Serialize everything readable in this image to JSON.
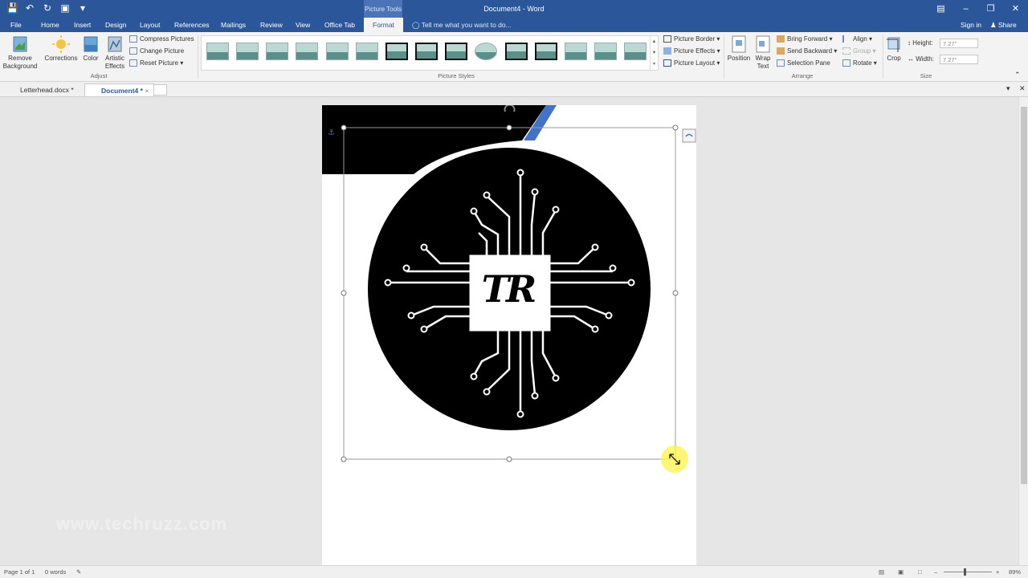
{
  "titlebar": {
    "doc_title": "Document4 - Word",
    "context_label": "Picture Tools"
  },
  "tabs": {
    "file": "File",
    "home": "Home",
    "insert": "Insert",
    "design": "Design",
    "layout": "Layout",
    "references": "References",
    "mailings": "Mailings",
    "review": "Review",
    "view": "View",
    "office_tab": "Office Tab",
    "format": "Format",
    "tell_me": "Tell me what you want to do...",
    "sign_in": "Sign in",
    "share": "Share"
  },
  "ribbon": {
    "remove_background": "Remove Background",
    "corrections": "Corrections",
    "color": "Color",
    "artistic_effects": "Artistic Effects",
    "compress_pictures": "Compress Pictures",
    "change_picture": "Change Picture",
    "reset_picture": "Reset Picture",
    "group_adjust": "Adjust",
    "group_picture_styles": "Picture Styles",
    "picture_border": "Picture Border",
    "picture_effects": "Picture Effects",
    "picture_layout": "Picture Layout",
    "position": "Position",
    "wrap_text": "Wrap Text",
    "bring_forward": "Bring Forward",
    "send_backward": "Send Backward",
    "selection_pane": "Selection Pane",
    "align": "Align",
    "group": "Group",
    "rotate": "Rotate",
    "group_arrange": "Arrange",
    "crop": "Crop",
    "height_label": "Height:",
    "height_value": "7.27\"",
    "width_label": "Width:",
    "width_value": "7.27\"",
    "group_size": "Size"
  },
  "doc_tabs": {
    "letterhead": "Letterhead.docx *",
    "document4": "Document4 *"
  },
  "logo": {
    "text": "TR"
  },
  "watermark": "www.techruzz.com",
  "status": {
    "page": "Page 1 of 1",
    "words": "0 words",
    "zoom": "89%"
  },
  "colors": {
    "word_blue": "#2b579a",
    "accent_stripe": "#4472c4",
    "logo_black": "#000000"
  }
}
